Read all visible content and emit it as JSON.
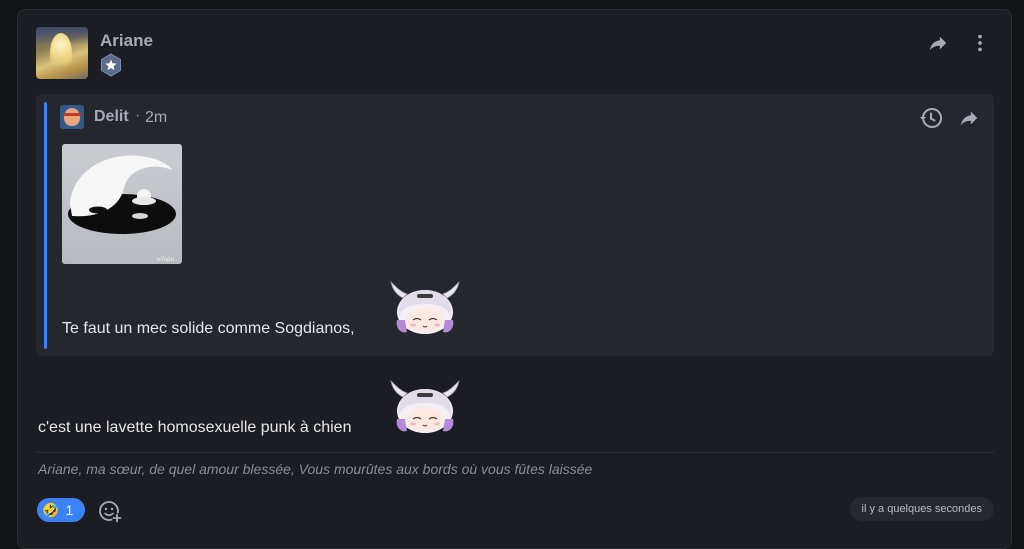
{
  "post": {
    "author": "Ariane",
    "badge_icon": "star-badge-icon",
    "actions": {
      "share_icon": "share-icon",
      "more_icon": "more-vertical-icon"
    }
  },
  "quote": {
    "author": "Delit",
    "separator": "·",
    "time": "2m",
    "actions": {
      "history_icon": "history-icon",
      "share_icon": "share-icon"
    },
    "image_tag": "wTopu...",
    "text": "Te faut un mec solide comme Sogdianos,"
  },
  "message": {
    "text": "c'est une lavette homosexuelle punk à chien"
  },
  "signature": "Ariane, ma sœur, de quel amour blessée, Vous mourûtes aux bords où vous fûtes laissée",
  "reactions": [
    {
      "emoji": "🤣",
      "count": "1"
    }
  ],
  "timestamp": "il y a quelques secondes",
  "colors": {
    "accent": "#3b82f6",
    "card_bg": "#1c1d22",
    "quote_bg": "#25272e"
  }
}
